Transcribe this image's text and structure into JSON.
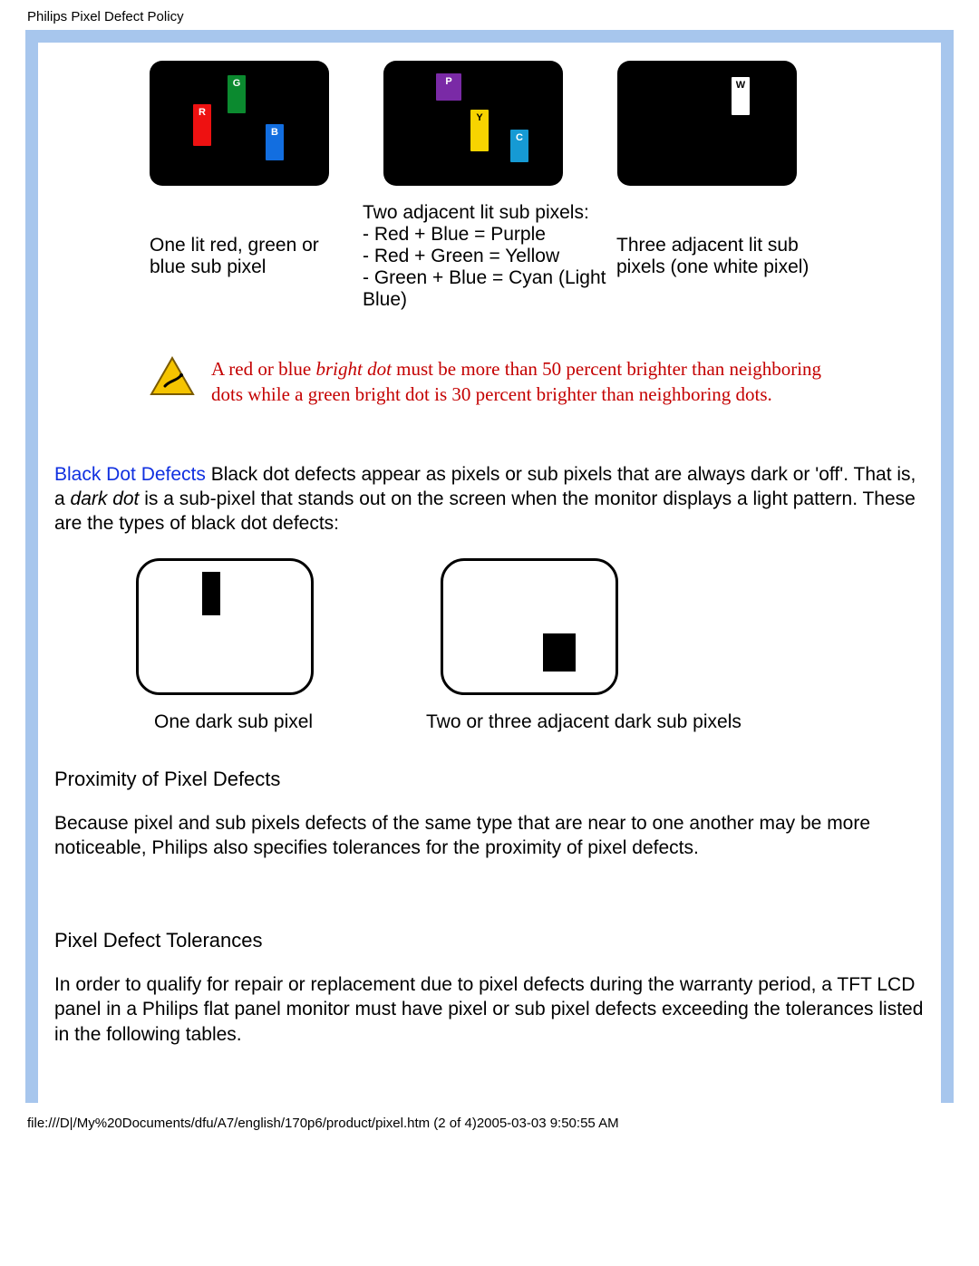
{
  "header_title": "Philips Pixel Defect Policy",
  "bright_dot_tiles": {
    "tile1": {
      "r": "R",
      "g": "G",
      "b": "B"
    },
    "tile2": {
      "p": "P",
      "y": "Y",
      "c": "C"
    },
    "tile3": {
      "w": "W"
    }
  },
  "captions": {
    "one_lit": "One lit red, green or blue sub pixel",
    "two_adj_line1": "Two adjacent lit sub pixels:",
    "two_adj_line2": "- Red + Blue = Purple",
    "two_adj_line3": "- Red + Green = Yellow",
    "two_adj_line4": "- Green + Blue = Cyan (Light Blue)",
    "three_adj": "Three adjacent lit sub pixels (one white pixel)"
  },
  "warning": {
    "part1": "A red or blue ",
    "bright_dot": "bright dot",
    "part2": " must be more than 50 percent brighter than neighboring dots while a green bright dot is 30 percent brighter than neighboring dots."
  },
  "black_dot": {
    "link": "Black Dot Defects",
    "text1": " Black dot defects appear as pixels or sub pixels that are always dark or 'off'. That is, a ",
    "dark_dot": "dark dot",
    "text2": " is a sub-pixel that stands out on the screen when the monitor displays a light pattern. These are the types of black dot defects:"
  },
  "dark_captions": {
    "one": "One dark sub pixel",
    "two_three": "Two or three adjacent dark sub pixels"
  },
  "proximity": {
    "title": "Proximity of Pixel Defects",
    "body": "Because pixel and sub pixels defects of the same type that are near to one another may be more noticeable, Philips also specifies tolerances for the proximity of pixel defects."
  },
  "tolerances": {
    "title": "Pixel Defect Tolerances",
    "body": "In order to qualify for repair or replacement due to pixel defects during the warranty period, a TFT LCD panel in a Philips flat panel monitor must have pixel or sub pixel defects exceeding the tolerances listed in the following tables."
  },
  "footer": "file:///D|/My%20Documents/dfu/A7/english/170p6/product/pixel.htm (2 of 4)2005-03-03 9:50:55 AM"
}
